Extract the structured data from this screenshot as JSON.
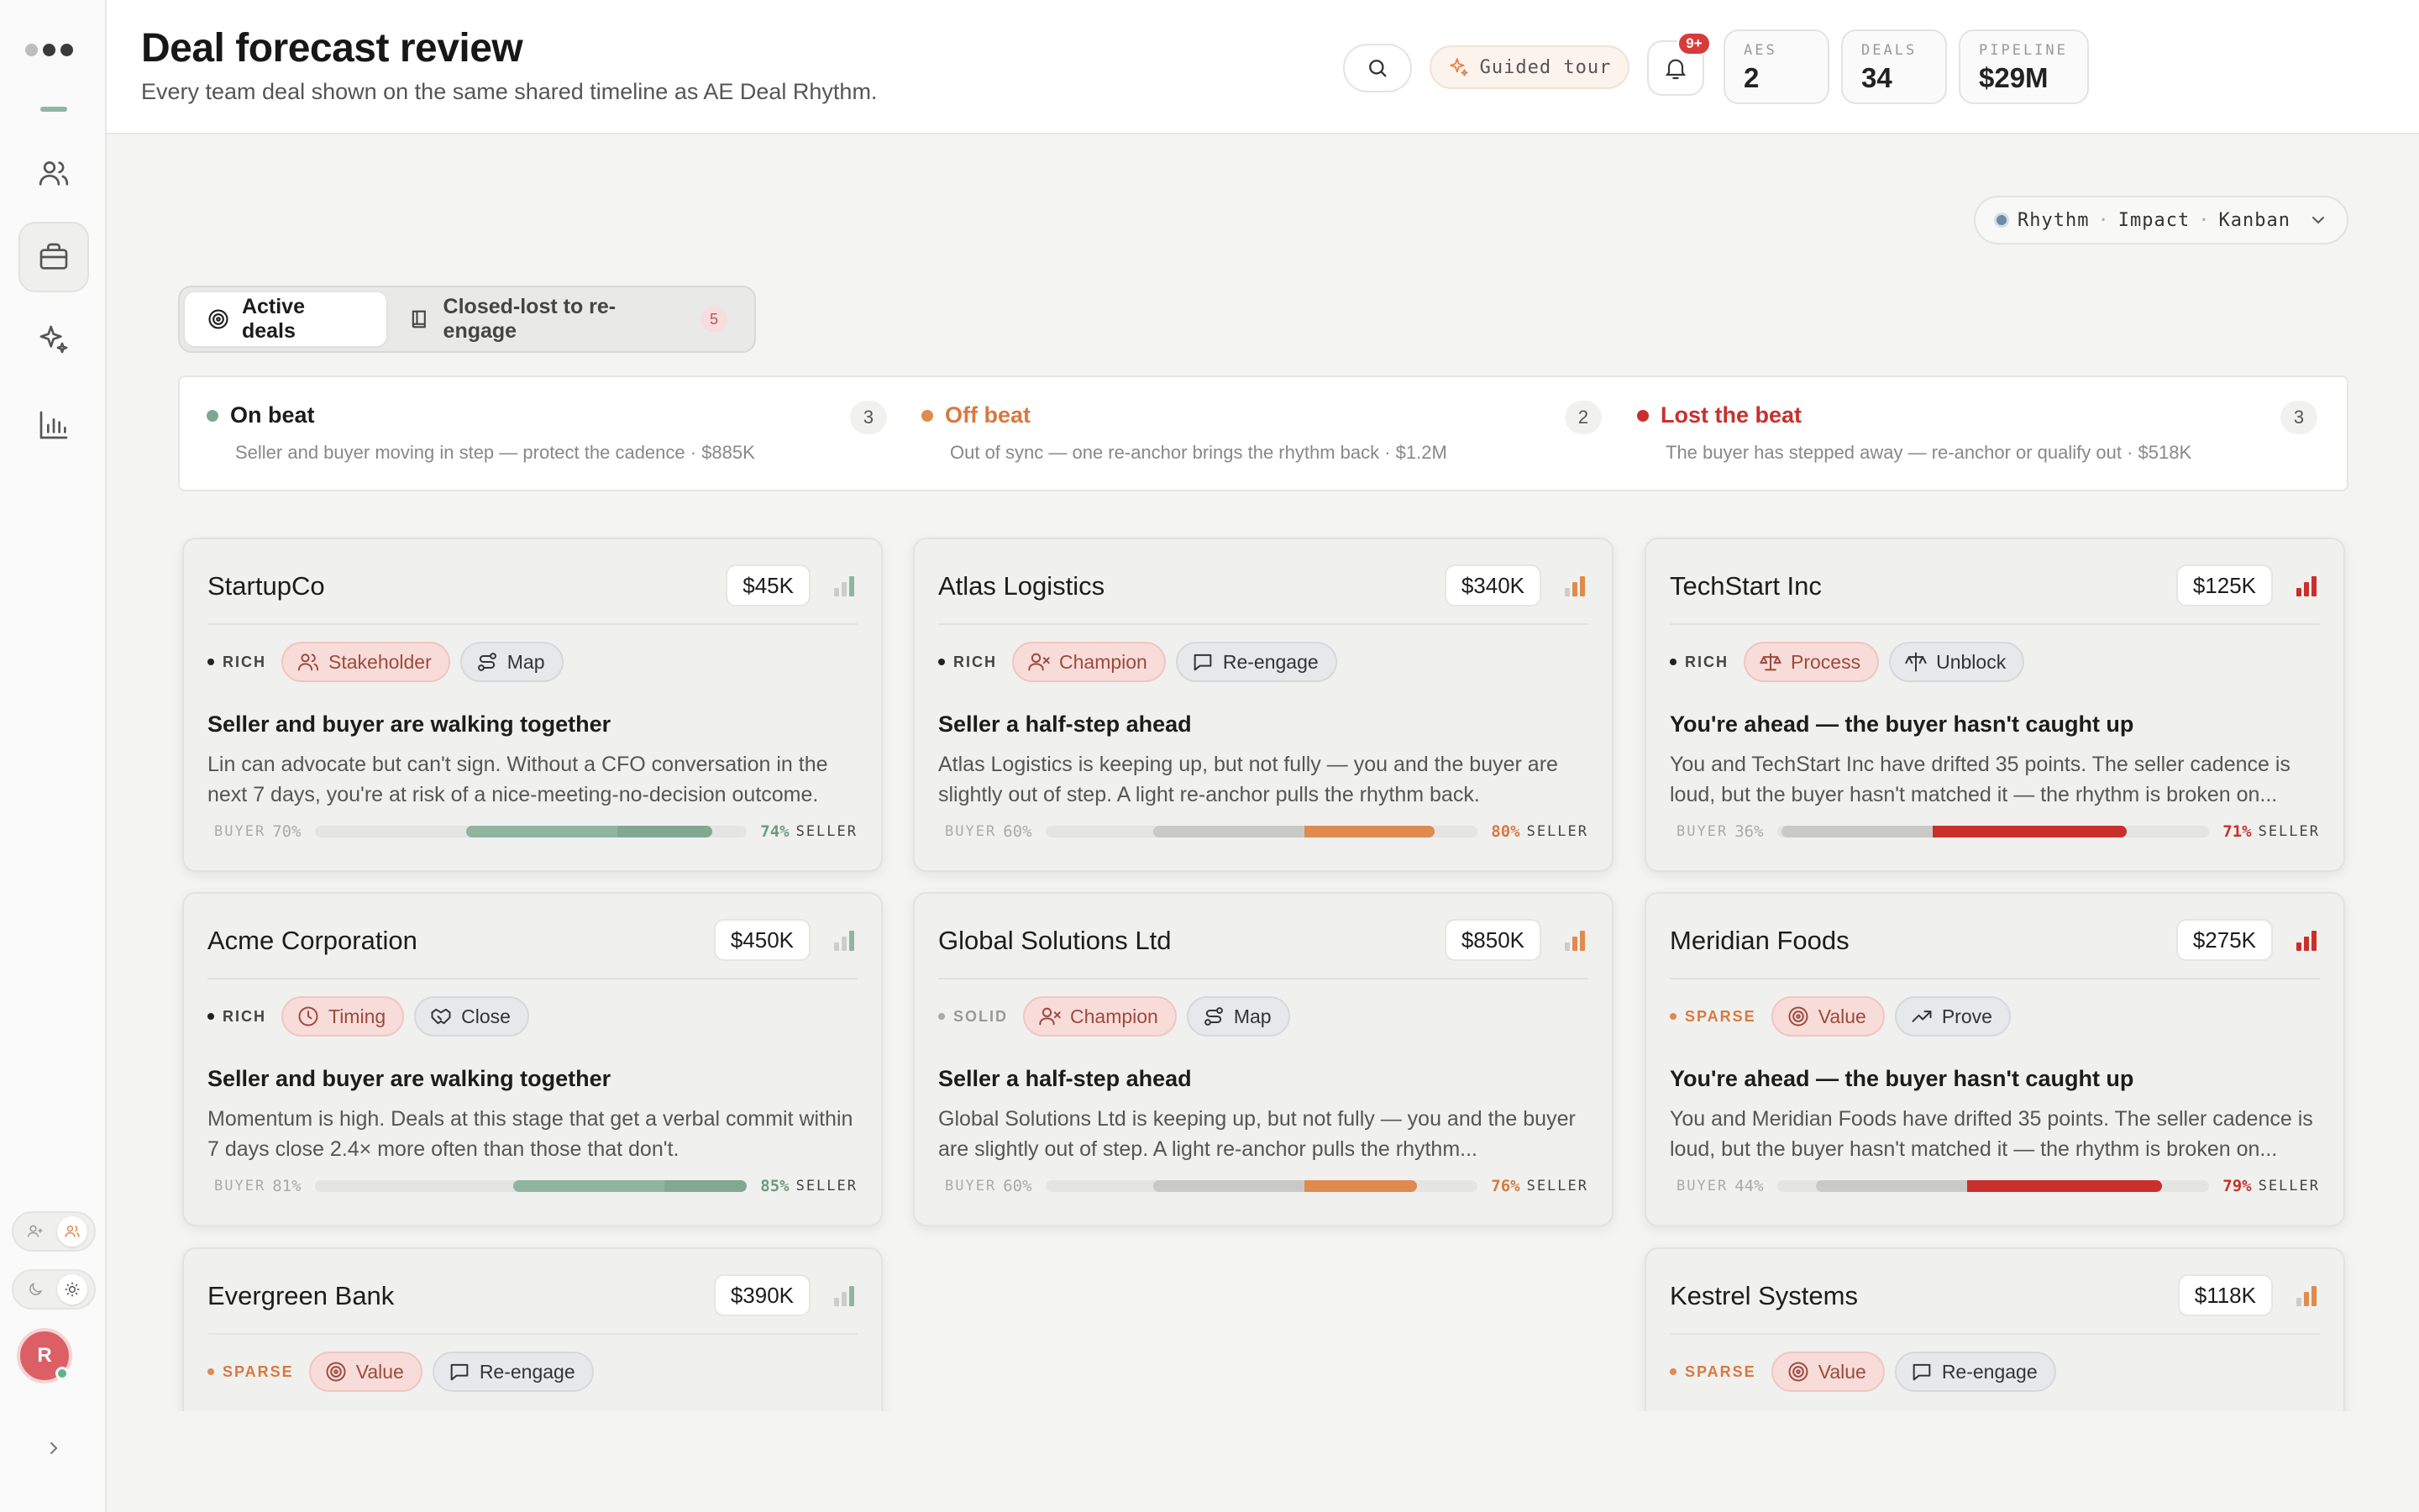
{
  "header": {
    "title": "Deal forecast review",
    "subtitle": "Every team deal shown on the same shared timeline as AE Deal Rhythm.",
    "guided_tour": "Guided tour",
    "notifications_badge": "9+",
    "stats": [
      {
        "label": "AES",
        "value": "2"
      },
      {
        "label": "DEALS",
        "value": "34"
      },
      {
        "label": "PIPELINE",
        "value": "$29M"
      }
    ]
  },
  "sidebar": {
    "avatar_initial": "R",
    "items": [
      "team-icon",
      "briefcase-icon",
      "sparkle-icon",
      "chart-icon"
    ]
  },
  "view_switch": {
    "options": [
      "Rhythm",
      "Impact",
      "Kanban"
    ],
    "separator": "·"
  },
  "segments": {
    "active": "Active deals",
    "closed_lost": "Closed-lost to re-engage",
    "closed_lost_count": "5"
  },
  "beats": [
    {
      "title": "On beat",
      "count": "3",
      "desc": "Seller and buyer moving in step — protect the cadence · $885K",
      "color": "#7fa78f"
    },
    {
      "title": "Off beat",
      "count": "2",
      "desc": "Out of sync — one re-anchor brings the rhythm back · $1.2M",
      "color": "#e08a4f"
    },
    {
      "title": "Lost the beat",
      "count": "3",
      "desc": "The buyer has stepped away — re-anchor or qualify out · $518K",
      "color": "#c9302c"
    }
  ],
  "bar_labels": {
    "buyer": "BUYER",
    "seller": "SELLER"
  },
  "cards": [
    {
      "name": "StartupCo",
      "amount": "$45K",
      "level": "RICH",
      "level_color": "#222",
      "tags": [
        {
          "label": "Stakeholder",
          "icon": "people-icon",
          "style": "red"
        },
        {
          "label": "Map",
          "icon": "route-icon",
          "style": "gray"
        }
      ],
      "headline": "Seller and buyer are walking together",
      "body": "Lin can advocate but can't sign. Without a CFO conversation in the next 7 days, you're at risk of a nice-meeting-no-decision outcome.",
      "buyer_pct": "70%",
      "seller_pct": "74%",
      "buyer": 0.7,
      "seller": 0.74,
      "beat": "on"
    },
    {
      "name": "Atlas Logistics",
      "amount": "$340K",
      "level": "RICH",
      "level_color": "#222",
      "tags": [
        {
          "label": "Champion",
          "icon": "user-x-icon",
          "style": "red"
        },
        {
          "label": "Re-engage",
          "icon": "message-icon",
          "style": "gray"
        }
      ],
      "headline": "Seller a half-step ahead",
      "body": "Atlas Logistics is keeping up, but not fully — you and the buyer are slightly out of step. A light re-anchor pulls the rhythm back.",
      "buyer_pct": "60%",
      "seller_pct": "80%",
      "buyer": 0.6,
      "seller": 0.8,
      "beat": "off"
    },
    {
      "name": "TechStart Inc",
      "amount": "$125K",
      "level": "RICH",
      "level_color": "#222",
      "tags": [
        {
          "label": "Process",
          "icon": "scale-icon",
          "style": "red"
        },
        {
          "label": "Unblock",
          "icon": "unblock-icon",
          "style": "gray"
        }
      ],
      "headline": "You're ahead — the buyer hasn't caught up",
      "body": "You and TechStart Inc have drifted 35 points. The seller cadence is loud, but the buyer hasn't matched it — the rhythm is broken on...",
      "buyer_pct": "36%",
      "seller_pct": "71%",
      "buyer": 0.36,
      "seller": 0.71,
      "beat": "lost"
    },
    {
      "name": "Acme Corporation",
      "amount": "$450K",
      "level": "RICH",
      "level_color": "#222",
      "tags": [
        {
          "label": "Timing",
          "icon": "clock-icon",
          "style": "red"
        },
        {
          "label": "Close",
          "icon": "handshake-icon",
          "style": "gray"
        }
      ],
      "headline": "Seller and buyer are walking together",
      "body": "Momentum is high. Deals at this stage that get a verbal commit within 7 days close 2.4× more often than those that don't.",
      "buyer_pct": "81%",
      "seller_pct": "85%",
      "buyer": 0.81,
      "seller": 0.85,
      "beat": "on"
    },
    {
      "name": "Global Solutions Ltd",
      "amount": "$850K",
      "level": "SOLID",
      "level_color": "#aaa",
      "tags": [
        {
          "label": "Champion",
          "icon": "user-x-icon",
          "style": "red"
        },
        {
          "label": "Map",
          "icon": "route-icon",
          "style": "gray"
        }
      ],
      "headline": "Seller a half-step ahead",
      "body": "Global Solutions Ltd is keeping up, but not fully — you and the buyer are slightly out of step. A light re-anchor pulls the rhythm...",
      "buyer_pct": "60%",
      "seller_pct": "76%",
      "buyer": 0.6,
      "seller": 0.76,
      "beat": "off"
    },
    {
      "name": "Meridian Foods",
      "amount": "$275K",
      "level": "SPARSE",
      "level_color": "#e08a4f",
      "tags": [
        {
          "label": "Value",
          "icon": "target-icon",
          "style": "red"
        },
        {
          "label": "Prove",
          "icon": "trend-icon",
          "style": "gray"
        }
      ],
      "headline": "You're ahead — the buyer hasn't caught up",
      "body": "You and Meridian Foods have drifted 35 points. The seller cadence is loud, but the buyer hasn't matched it — the rhythm is broken on...",
      "buyer_pct": "44%",
      "seller_pct": "79%",
      "buyer": 0.44,
      "seller": 0.79,
      "beat": "lost"
    },
    {
      "name": "Evergreen Bank",
      "amount": "$390K",
      "level": "SPARSE",
      "level_color": "#e08a4f",
      "tags": [
        {
          "label": "Value",
          "icon": "target-icon",
          "style": "red"
        },
        {
          "label": "Re-engage",
          "icon": "message-icon",
          "style": "gray"
        }
      ],
      "headline": "",
      "body": "",
      "buyer_pct": "",
      "seller_pct": "",
      "buyer": 0,
      "seller": 0,
      "beat": "on"
    },
    {
      "name": "Kestrel Systems",
      "amount": "$118K",
      "level": "SPARSE",
      "level_color": "#e08a4f",
      "tags": [
        {
          "label": "Value",
          "icon": "target-icon",
          "style": "red"
        },
        {
          "label": "Re-engage",
          "icon": "message-icon",
          "style": "gray"
        }
      ],
      "headline": "",
      "body": "",
      "buyer_pct": "",
      "seller_pct": "",
      "buyer": 0,
      "seller": 0,
      "beat": "off"
    }
  ]
}
